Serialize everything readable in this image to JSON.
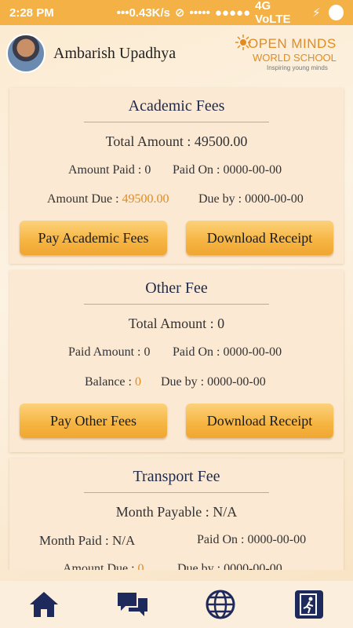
{
  "status_bar": {
    "time": "2:28 PM",
    "speed": "0.43K/s",
    "network": "4G VoLTE"
  },
  "header": {
    "user_name": "Ambarish Upadhya",
    "logo": {
      "line1": "OPEN MINDS",
      "line2": "WORLD SCHOOL",
      "tagline": "Inspiring young minds"
    }
  },
  "academic": {
    "title": "Academic Fees",
    "total_amount": "Total Amount : 49500.00",
    "amount_paid": "Amount Paid : 0",
    "paid_on": "Paid On : 0000-00-00",
    "amount_due_label": "Amount Due : ",
    "amount_due_value": "49500.00",
    "due_by": "Due by : 0000-00-00",
    "pay_button": "Pay Academic Fees",
    "download_button": "Download Receipt"
  },
  "other": {
    "title": "Other Fee",
    "total_amount": "Total Amount : 0",
    "paid_amount": "Paid Amount : 0",
    "paid_on": "Paid On : 0000-00-00",
    "balance_label": "Balance : ",
    "balance_value": "0",
    "due_by": "Due by : 0000-00-00",
    "pay_button": "Pay Other Fees",
    "download_button": "Download Receipt"
  },
  "transport": {
    "title": "Transport Fee",
    "month_payable": "Month Payable : N/A",
    "month_paid": "Month Paid : N/A",
    "paid_on": "Paid On : 0000-00-00",
    "amount_due_label": "Amount Due : ",
    "amount_due_value": "0",
    "due_by": "Due by : 0000-00-00"
  },
  "nav": {
    "icons": [
      "home-icon",
      "chat-icon",
      "globe-icon",
      "exit-icon"
    ],
    "color": "#1f2a5c"
  }
}
